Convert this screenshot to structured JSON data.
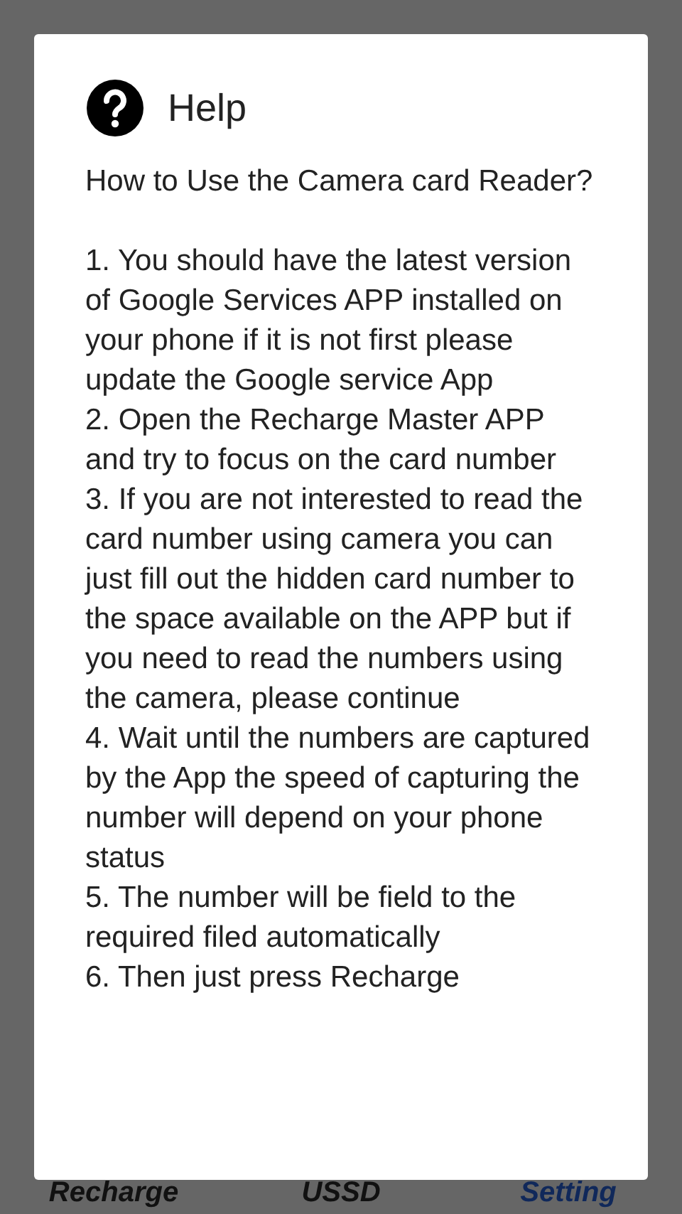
{
  "dialog": {
    "title": "Help",
    "question": "How to Use the Camera card Reader?",
    "steps": [
      "1. You should have the latest version of Google Services APP installed on your phone if it is not first please update the Google service App",
      "2. Open the Recharge Master APP and try to focus on the card number",
      "3. If you are not interested to read the card number using camera you can just fill out the hidden card number to the space available on the APP but if you need to read the numbers using the camera, please continue",
      "4. Wait until the numbers are captured by the App the speed of capturing the number will depend on your phone status",
      "5. The number will be field to the required filed automatically",
      "6. Then just press Recharge"
    ]
  },
  "tabs": [
    {
      "label": "Recharge",
      "selected": false
    },
    {
      "label": "USSD",
      "selected": false
    },
    {
      "label": "Setting",
      "selected": true
    }
  ]
}
